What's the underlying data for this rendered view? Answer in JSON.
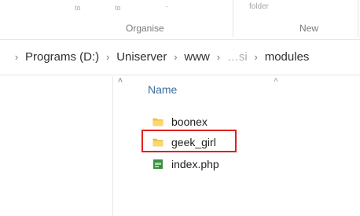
{
  "ribbon": {
    "faded_btn_a": "to",
    "faded_btn_b": "to",
    "faded_btn_c": "⁻",
    "folder_label": "folder",
    "group_organise": "Organise",
    "group_new": "New"
  },
  "breadcrumb": {
    "items": [
      {
        "label": "Programs (D:)"
      },
      {
        "label": "Uniserver"
      },
      {
        "label": "www"
      },
      {
        "label": "…si"
      },
      {
        "label": "modules"
      }
    ],
    "separator": "›"
  },
  "nav": {
    "scroll_up_glyph": "˄"
  },
  "list": {
    "header": "Name",
    "sort_glyph": "˄",
    "items": [
      {
        "name": "boonex",
        "icon": "folder-icon"
      },
      {
        "name": "geek_girl",
        "icon": "folder-icon"
      },
      {
        "name": "index.php",
        "icon": "php-file-icon"
      }
    ]
  },
  "annotation": {
    "highlight_color": "#e02020"
  }
}
